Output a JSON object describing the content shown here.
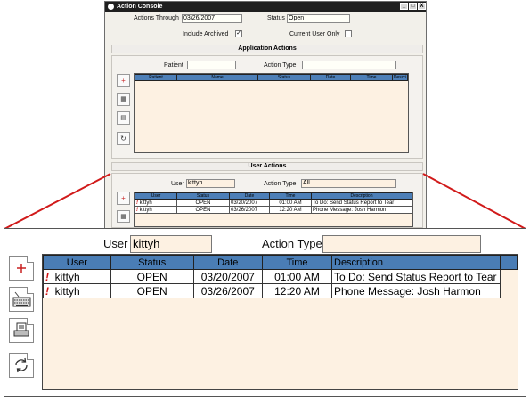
{
  "window": {
    "title": "Action Console",
    "buttons": [
      "_",
      "□",
      "X"
    ]
  },
  "filters": {
    "actions_through_label": "Actions Through",
    "actions_through_value": "03/26/2007",
    "status_label": "Status",
    "status_value": "Open",
    "include_archived_label": "Include Archived",
    "include_archived_checked": true,
    "current_user_only_label": "Current User Only",
    "current_user_only_checked": false
  },
  "application_actions": {
    "header": "Application Actions",
    "patient_label": "Patient",
    "patient_value": "",
    "action_type_label": "Action Type",
    "action_type_value": "",
    "columns": [
      "Patient",
      "Name",
      "Status",
      "Date",
      "Time",
      "Descri"
    ]
  },
  "user_actions": {
    "header": "User Actions",
    "user_label": "User",
    "user_value": "kittyh",
    "action_type_label": "Action Type",
    "action_type_value": "All",
    "columns": [
      "User",
      "Status",
      "Date",
      "Time",
      "Description"
    ],
    "rows": [
      {
        "flag": "!",
        "user": "kittyh",
        "status": "OPEN",
        "date": "03/20/2007",
        "time": "01:00 AM",
        "description": "To Do: Send Status Report to Tear"
      },
      {
        "flag": "!",
        "user": "kittyh",
        "status": "OPEN",
        "date": "03/26/2007",
        "time": "12:20 AM",
        "description": "Phone Message: Josh Harmon"
      }
    ]
  },
  "zoom": {
    "user_label": "User",
    "user_value": "kittyh",
    "action_type_label": "Action Type",
    "action_type_value": "",
    "toolbar_icons": [
      "add-icon",
      "keyboard-icon",
      "print-icon",
      "refresh-icon"
    ]
  },
  "colors": {
    "grid_header": "#4a7db5",
    "grid_background": "#fdf1e2",
    "callout_line": "#d11a1a",
    "flag": "#d01010"
  }
}
